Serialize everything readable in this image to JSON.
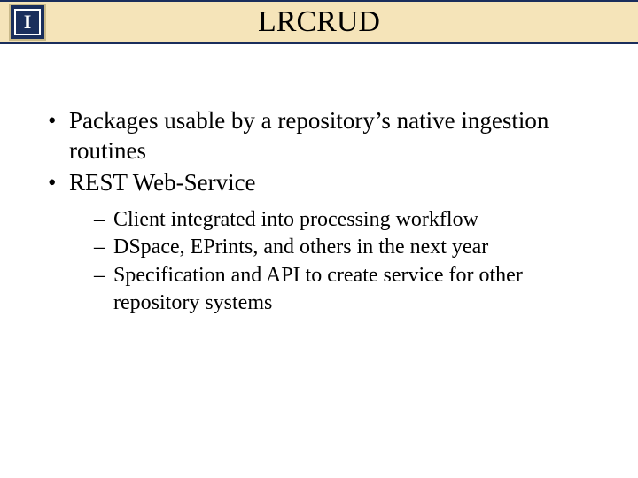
{
  "header": {
    "title": "LRCRUD",
    "logo_letter": "I"
  },
  "bullets": [
    {
      "text": "Packages usable by a repository’s native ingestion routines"
    },
    {
      "text": "REST Web-Service",
      "sub": [
        "Client integrated into processing workflow",
        "DSpace, EPrints, and others in the next year",
        "Specification and API to create service for other repository systems"
      ]
    }
  ]
}
